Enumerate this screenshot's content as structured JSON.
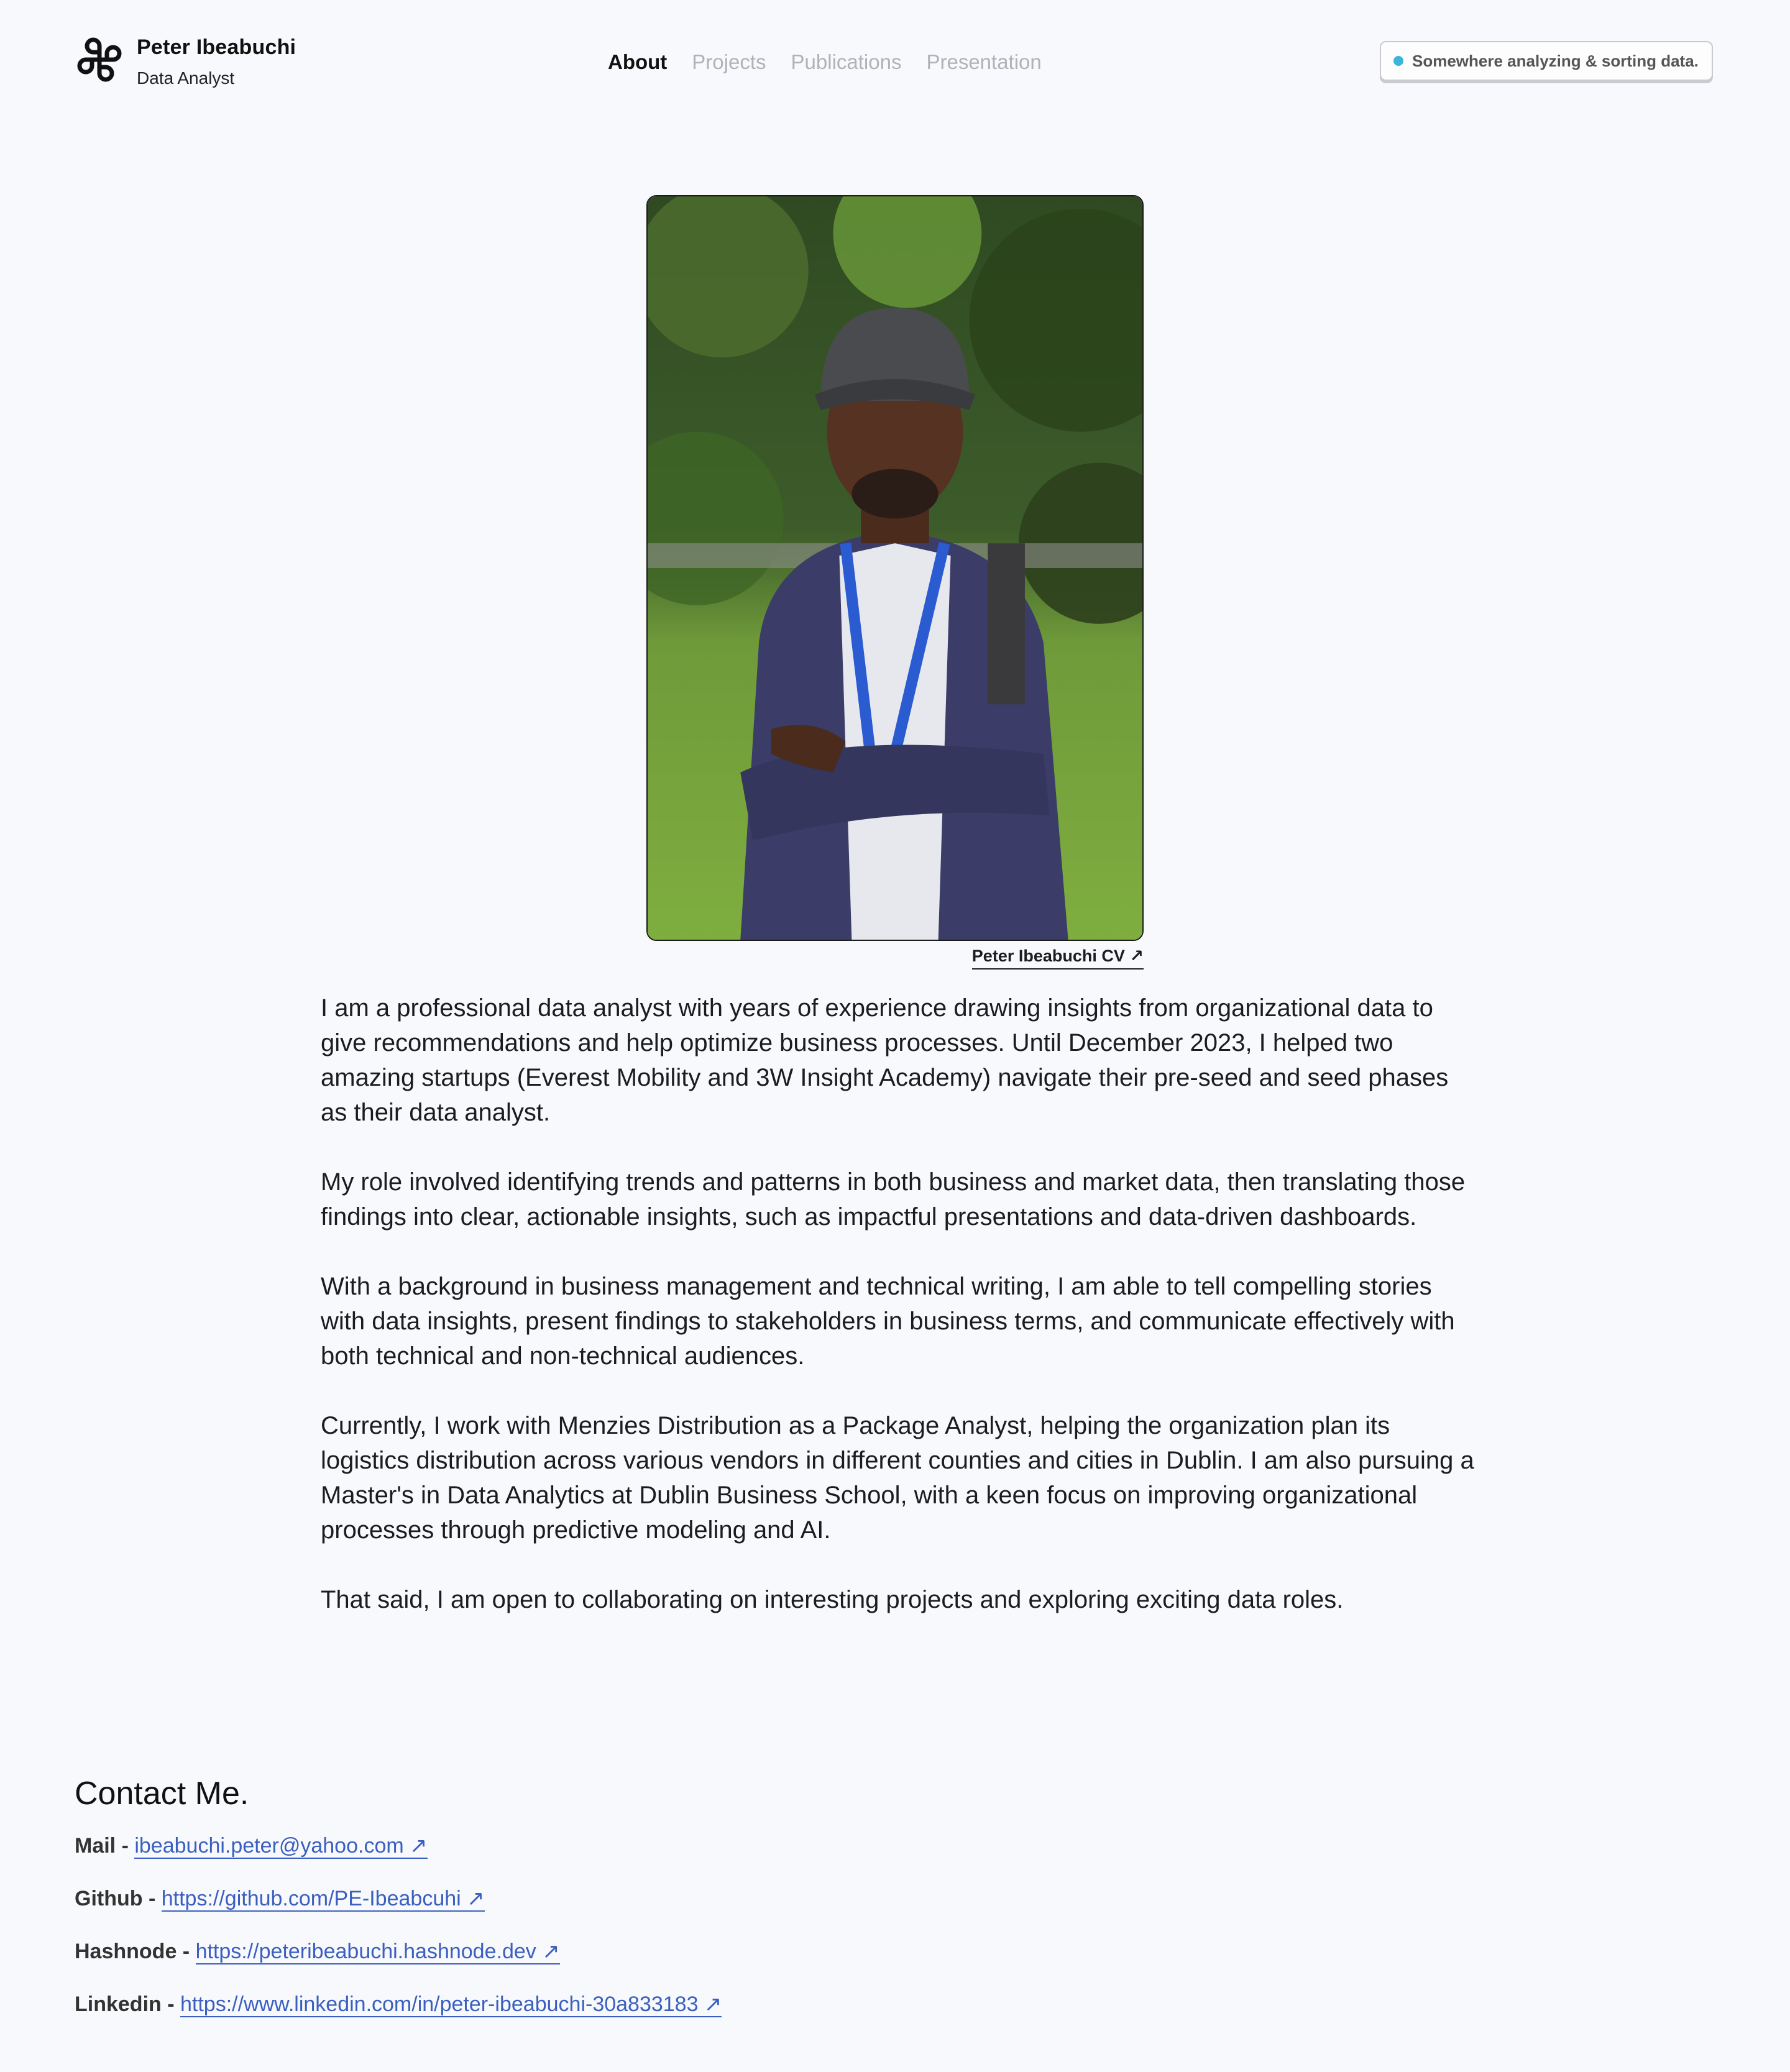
{
  "header": {
    "name": "Peter Ibeabuchi",
    "role": "Data Analyst",
    "nav": [
      "About",
      "Projects",
      "Publications",
      "Presentation"
    ],
    "active_nav": "About",
    "status": "Somewhere analyzing & sorting data."
  },
  "photo": {
    "cv_link_label": "Peter Ibeabuchi CV ↗"
  },
  "bio": [
    "I am a professional data analyst with years of experience drawing insights from organizational data to give recommendations and help optimize business processes. Until December 2023, I helped two amazing startups (Everest Mobility and 3W Insight Academy) navigate their pre-seed and seed phases as their data analyst.",
    "My role involved identifying trends and patterns in both business and market data, then translating those findings into clear, actionable insights, such as impactful presentations and data-driven dashboards.",
    "With a background in business management and technical writing, I am able to tell compelling stories with data insights, present findings to stakeholders in business terms, and communicate effectively with both technical and non-technical audiences.",
    "Currently, I work with Menzies Distribution as a Package Analyst, helping the organization plan its logistics distribution across various vendors in different counties and cities in Dublin. I am also pursuing a Master's in Data Analytics at Dublin Business School, with a keen focus on improving organizational processes through predictive modeling and AI.",
    "That said, I am open to collaborating on interesting projects and exploring exciting data roles."
  ],
  "contact": {
    "heading": "Contact Me.",
    "items": [
      {
        "label": "Mail - ",
        "link": "ibeabuchi.peter@yahoo.com ↗"
      },
      {
        "label": "Github - ",
        "link": "https://github.com/PE-Ibeabcuhi ↗"
      },
      {
        "label": "Hashnode - ",
        "link": "https://peteribeabuchi.hashnode.dev ↗"
      },
      {
        "label": "Linkedin - ",
        "link": "https://www.linkedin.com/in/peter-ibeabuchi-30a833183 ↗"
      }
    ]
  },
  "colors": {
    "background": "#f8f9fc",
    "link": "#3a5fc0",
    "status_dot": "#3bb5d9",
    "nav_inactive": "#b0b2b8"
  },
  "icons": [
    "logo-icon",
    "status-dot-icon",
    "external-link-icon"
  ]
}
